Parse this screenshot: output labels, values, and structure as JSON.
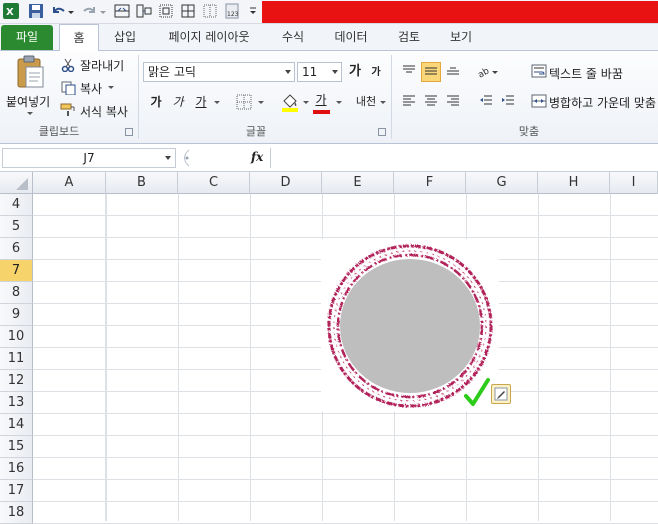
{
  "tabs": {
    "file": "파일",
    "home": "홈",
    "insert": "삽입",
    "page_layout": "페이지 레이아웃",
    "formulas": "수식",
    "data": "데이터",
    "review": "검토",
    "view": "보기"
  },
  "ribbon": {
    "clipboard": {
      "paste": "붙여넣기",
      "cut": "잘라내기",
      "copy": "복사",
      "format_painter": "서식 복사",
      "group_label": "클립보드"
    },
    "font": {
      "font_name": "맑은 고딕",
      "font_size": "11",
      "grow": "가",
      "shrink": "가",
      "bold": "가",
      "italic": "가",
      "underline": "가",
      "font_color_glyph": "가",
      "phonetic": "내천",
      "group_label": "글꼴"
    },
    "alignment": {
      "wrap_text": "텍스트 줄 바꿈",
      "merge_center": "병합하고 가운데 맞춤",
      "group_label": "맞춤"
    }
  },
  "formula_bar": {
    "name_box": "J7",
    "fx": "fx",
    "value": ""
  },
  "grid": {
    "columns": [
      "A",
      "B",
      "C",
      "D",
      "E",
      "F",
      "G",
      "H",
      "I"
    ],
    "rows": [
      "4",
      "5",
      "6",
      "7",
      "8",
      "9",
      "10",
      "11",
      "12",
      "13",
      "14",
      "15",
      "16",
      "17",
      "18"
    ],
    "active_row": "7"
  },
  "colors": {
    "file_tab": "#2b8a2f",
    "title_bar": "#e81212",
    "active_row_header": "#f7d36b",
    "stamp_ring": "#b2245a",
    "stamp_fill": "#bebebe",
    "check": "#2ecc1a"
  }
}
